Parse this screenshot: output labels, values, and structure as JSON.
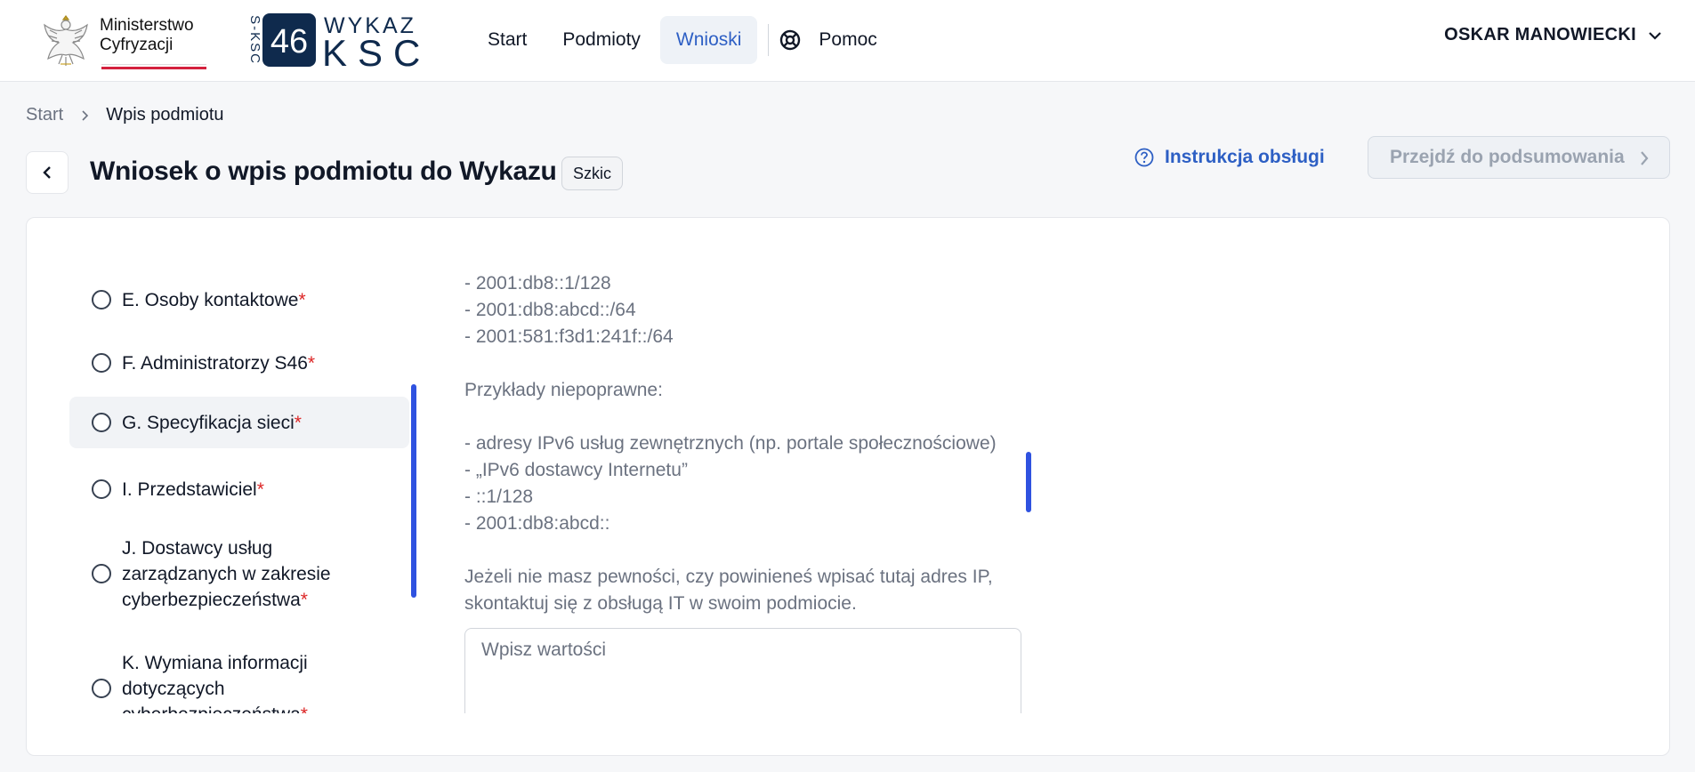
{
  "header": {
    "ministry_line1": "Ministerstwo",
    "ministry_line2": "Cyfryzacji",
    "ksc_logo_number": "46",
    "ksc_logo_wykaz": "WYKAZ",
    "ksc_logo_ksc": "KSC",
    "ksc_logo_side": "S-KSC",
    "nav": [
      {
        "label": "Start"
      },
      {
        "label": "Podmioty"
      },
      {
        "label": "Wnioski",
        "active": true
      }
    ],
    "help_label": "Pomoc",
    "user_name": "OSKAR MANOWIECKI",
    "accent_color": "#2d5fc4"
  },
  "breadcrumb": {
    "start": "Start",
    "current": "Wpis podmiotu"
  },
  "page": {
    "title": "Wniosek o wpis podmiotu do Wykazu",
    "status_badge": "Szkic",
    "manual_link": "Instrukcja obsługi",
    "summary_button": "Przejdź do podsumowania"
  },
  "steps": [
    {
      "label": "E. Osoby kontaktowe",
      "required_mark": "*"
    },
    {
      "label": "F. Administratorzy S46",
      "required_mark": "*"
    },
    {
      "label": "G. Specyfikacja sieci",
      "required_mark": "*",
      "active": true
    },
    {
      "label": "I. Przedstawiciel",
      "required_mark": "*"
    },
    {
      "label_lines": [
        "J. Dostawcy usług",
        "zarządzanych w zakresie",
        "cyberbezpieczeństwa"
      ],
      "required_mark": "*"
    },
    {
      "label_lines": [
        "K. Wymiana informacji",
        "dotyczących",
        "cyberbezpieczeństwa"
      ],
      "required_mark": "*"
    }
  ],
  "help_text": {
    "correct_examples": [
      "- 2001:db8::1/128",
      "- 2001:db8:abcd::/64",
      "- 2001:581:f3d1:241f::/64"
    ],
    "incorrect_heading": "Przykłady niepoprawne:",
    "incorrect_examples": [
      "- adresy IPv6 usług zewnętrznych (np. portale społecznościowe)",
      "- „IPv6 dostawcy Internetu”",
      "- ::1/128",
      "- 2001:db8:abcd::"
    ],
    "note": "Jeżeli nie masz pewności, czy powinieneś wpisać tutaj adres IP, skontaktuj się z obsługą IT w swoim podmiocie."
  },
  "values_input": {
    "placeholder": "Wpisz wartości",
    "value": ""
  }
}
